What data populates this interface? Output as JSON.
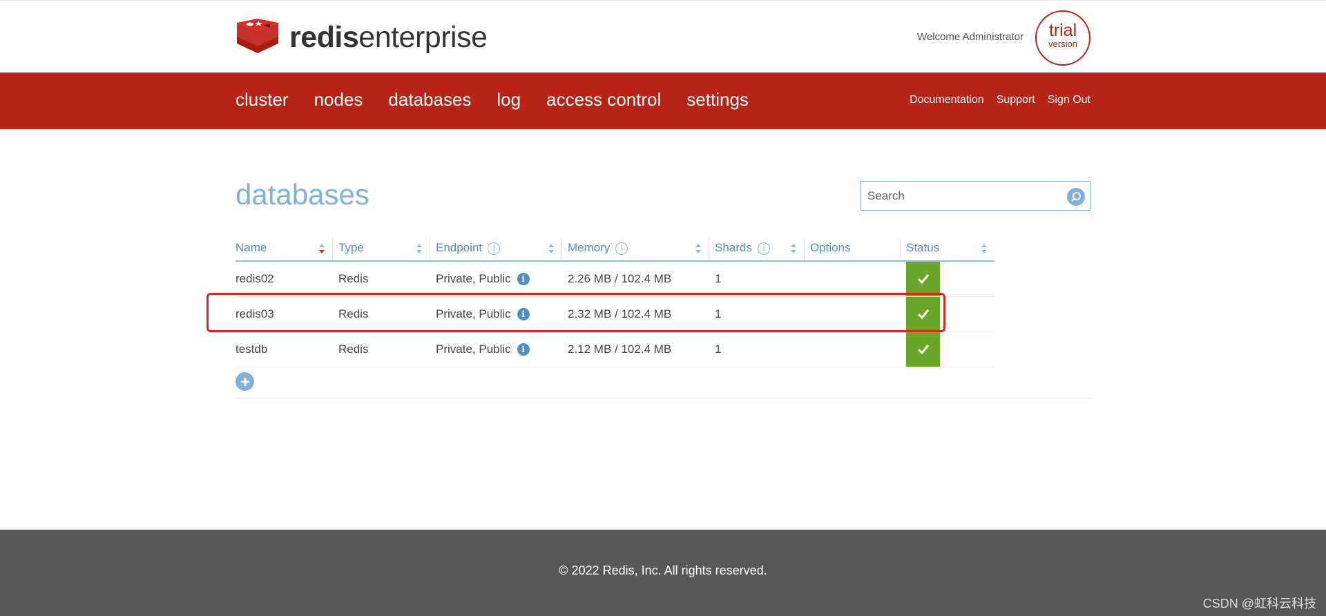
{
  "brand": {
    "name_bold": "redis",
    "name_light": "enterprise"
  },
  "header": {
    "welcome": "Welcome Administrator",
    "trial_top": "trial",
    "trial_bottom": "version"
  },
  "nav": {
    "items": [
      "cluster",
      "nodes",
      "databases",
      "log",
      "access control",
      "settings"
    ],
    "right": [
      "Documentation",
      "Support",
      "Sign Out"
    ]
  },
  "page": {
    "title": "databases"
  },
  "search": {
    "placeholder": "Search"
  },
  "table": {
    "headers": {
      "name": "Name",
      "type": "Type",
      "endpoint": "Endpoint",
      "memory": "Memory",
      "shards": "Shards",
      "options": "Options",
      "status": "Status"
    },
    "rows": [
      {
        "name": "redis02",
        "type": "Redis",
        "endpoint": "Private, Public",
        "memory": "2.26 MB / 102.4 MB",
        "shards": "1",
        "status": "ok"
      },
      {
        "name": "redis03",
        "type": "Redis",
        "endpoint": "Private, Public",
        "memory": "2.32 MB / 102.4 MB",
        "shards": "1",
        "status": "ok"
      },
      {
        "name": "testdb",
        "type": "Redis",
        "endpoint": "Private, Public",
        "memory": "2.12 MB / 102.4 MB",
        "shards": "1",
        "status": "ok"
      }
    ]
  },
  "footer": {
    "copyright": "© 2022 Redis, Inc. All rights reserved."
  },
  "watermark": "CSDN @虹科云科技",
  "colors": {
    "brand_red": "#b72416",
    "accent_blue": "#7fb1d9",
    "status_green": "#6aa627",
    "highlight": "#e2261c"
  }
}
